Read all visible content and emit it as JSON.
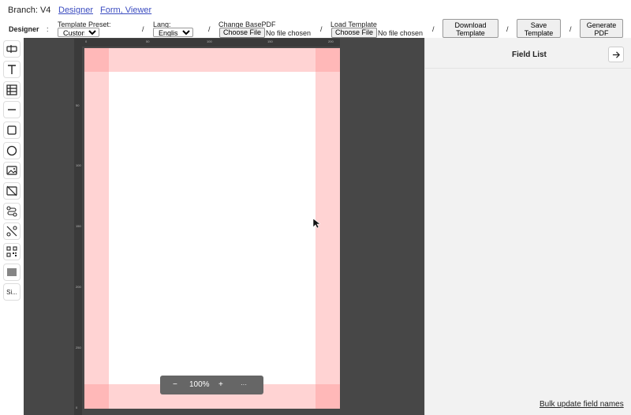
{
  "nav": {
    "branch": "Branch: V4",
    "link_designer": "Designer",
    "link_form_viewer": "Form, Viewer"
  },
  "toolbar": {
    "designer_label": "Designer",
    "colon": ":",
    "template_preset_label": "Template Preset:",
    "template_preset_value": "Custom",
    "lang_label": "Lang:",
    "lang_value": "English",
    "change_basepdf_label": "Change BasePDF",
    "choose_file": "Choose File",
    "no_file": "No file chosen",
    "load_template_label": "Load Template",
    "download_template_line1": "Download",
    "download_template_line2": "Template",
    "save_template_line1": "Save",
    "save_template_line2": "Template",
    "generate_pdf_line1": "Generate",
    "generate_pdf_line2": "PDF",
    "separator": "/"
  },
  "tools": [
    {
      "name": "text-field-icon"
    },
    {
      "name": "text-icon"
    },
    {
      "name": "table-icon"
    },
    {
      "name": "line-icon"
    },
    {
      "name": "rectangle-icon"
    },
    {
      "name": "ellipse-icon"
    },
    {
      "name": "image-icon"
    },
    {
      "name": "svg-icon"
    },
    {
      "name": "path-icon"
    },
    {
      "name": "unlink-icon"
    },
    {
      "name": "qrcode-icon"
    },
    {
      "name": "barcode-icon"
    },
    {
      "name": "signature-tool",
      "label": "Si..."
    }
  ],
  "ruler": {
    "top_ticks": [
      "0",
      "50",
      "100",
      "150",
      "200"
    ],
    "left_ticks": [
      "50",
      "100",
      "150",
      "200",
      "250",
      "0"
    ]
  },
  "zoom": {
    "minus": "−",
    "level": "100%",
    "plus": "+",
    "more": "···"
  },
  "field_list": {
    "title": "Field List",
    "bulk_update": "Bulk update field names"
  },
  "colors": {
    "canvas_bg": "#474747",
    "padding_overlay": "#ffc9c9",
    "panel_bg": "#f2f2f2",
    "link": "#3b4cc0"
  }
}
